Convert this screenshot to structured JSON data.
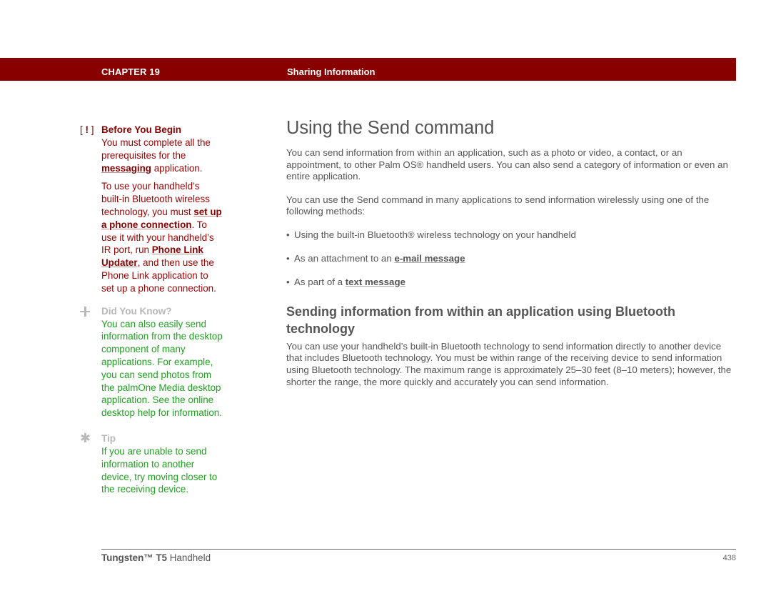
{
  "header": {
    "chapter": "CHAPTER 19",
    "section": "Sharing Information",
    "bar_color": "#880000"
  },
  "sidebar": {
    "before_you_begin": {
      "icon": "exclamation-bracket-icon",
      "icon_text_open": "[",
      "icon_text_mark": "!",
      "icon_text_close": "]",
      "title": "Before You Begin",
      "p1_a": "You must complete all the prerequisites for the ",
      "p1_link": "messaging",
      "p1_b": " application.",
      "p2_a": "To use your handheld’s built-in Bluetooth wireless technology, you must ",
      "p2_link1": "set up a phone connection",
      "p2_b": ". To use it with your handheld’s IR port, run ",
      "p2_link2": "Phone Link Updater",
      "p2_c": ", and then use the Phone Link application to set up a phone connection."
    },
    "did_you_know": {
      "icon": "plus-icon",
      "title": "Did You Know?",
      "body": "You can also easily send information from the desktop component of many applications. For example, you can send photos from the palmOne Media desktop application. See the online desktop help for information."
    },
    "tip": {
      "icon": "asterisk-icon",
      "icon_glyph": "✱",
      "title": "Tip",
      "body": "If you are unable to send information to another device, try moving closer to the receiving device."
    }
  },
  "main": {
    "title": "Using the Send command",
    "intro": "You can send information from within an application, such as a photo or video, a contact, or an appointment, to other Palm OS® handheld users. You can also send a category of information or even an entire application.",
    "methods_intro": "You can use the Send command in many applications to send information wirelessly using one of the following methods:",
    "bullet_glyph": "•",
    "bullets": [
      {
        "text": "Using the built-in Bluetooth® wireless technology on your handheld",
        "link": ""
      },
      {
        "text": "As an attachment to an ",
        "link": "e-mail message"
      },
      {
        "text": "As part of a ",
        "link": "text message"
      }
    ],
    "subheading": "Sending information from within an application using Bluetooth technology",
    "subpara": "You can use your handheld’s built-in Bluetooth technology to send information directly to another device that includes Bluetooth technology. You must be within range of the receiving device to send information using Bluetooth technology. The maximum range is approximately 25–30 feet (8–10 meters); however, the shorter the range, the more quickly and accurately you can send information."
  },
  "footer": {
    "product_bold": "Tungsten™ T5",
    "product_rest": " Handheld",
    "page_number": "438"
  }
}
